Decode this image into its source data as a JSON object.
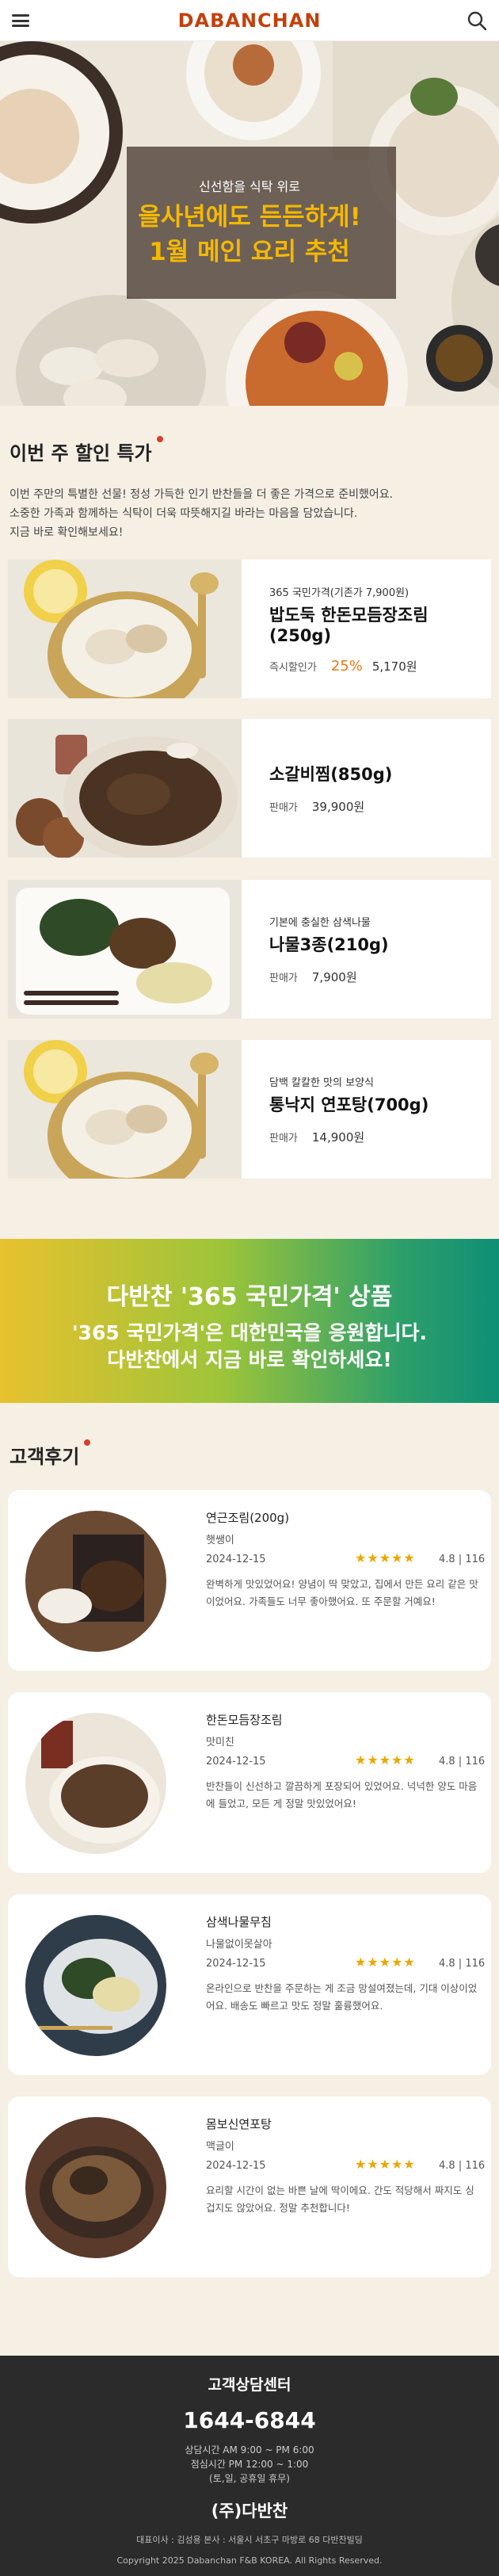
{
  "header": {
    "logo": "DABANCHAN"
  },
  "hero": {
    "subtitle": "신선함을 식탁 위로",
    "title_line1": "을사년에도 든든하게!",
    "title_line2": "1월 메인 요리 추천"
  },
  "discount_section": {
    "title": "이번 주 할인 특가",
    "intro_lines": [
      "이번 주만의 특별한 선물! 정성 가득한 인기 반찬들을 더 좋은 가격으로 준비했어요.",
      "소중한 가족과 함께하는 식탁이 더욱 따뜻해지길 바라는 마음을 담았습니다.",
      "지금 바로 확인해보세요!"
    ],
    "products": [
      {
        "desc": "365 국민가격(기존가 7,900원)",
        "name": "밥도둑 한돈모듬장조림(250g)",
        "label": "즉시할인가",
        "discount": "25%",
        "price": "5,170원"
      },
      {
        "desc": "",
        "name": "소갈비찜(850g)",
        "label": "판매가",
        "discount": "",
        "price": "39,900원"
      },
      {
        "desc": "기본에 충실한 삼색나물",
        "name": "나물3종(210g)",
        "label": "판매가",
        "discount": "",
        "price": "7,900원"
      },
      {
        "desc": "담백 칼칼한 맛의 보양식",
        "name": "통낙지 연포탕(700g)",
        "label": "판매가",
        "discount": "",
        "price": "14,900원"
      }
    ]
  },
  "banner": {
    "line1": "다반찬 '365 국민가격' 상품",
    "line2": "'365 국민가격'은 대한민국을 응원합니다.",
    "line3": "다반찬에서 지금 바로 확인하세요!"
  },
  "reviews_section": {
    "title": "고객후기",
    "reviews": [
      {
        "product": "연근조림(200g)",
        "user": "햇쌩이",
        "date": "2024-12-15",
        "stars": "★★★★★",
        "score": "4.8 | 116",
        "text": "완벽하게 맛있었어요! 양념이 딱 맞았고, 집에서 만든 요리 같은 맛이었어요. 가족들도 너무 좋아했어요. 또 주문할 거예요!"
      },
      {
        "product": "한돈모듬장조림",
        "user": "맛미친",
        "date": "2024-12-15",
        "stars": "★★★★★",
        "score": "4.8 | 116",
        "text": "반찬들이 신선하고 깔끔하게 포장되어 있었어요. 넉넉한 양도 마음에 들었고, 모든 게 정말 맛있었어요!"
      },
      {
        "product": "삼색나물무침",
        "user": "나물없이못살아",
        "date": "2024-12-15",
        "stars": "★★★★★",
        "score": "4.8 | 116",
        "text": "온라인으로 반찬을 주문하는 게 조금 망설여졌는데, 기대 이상이었어요. 배송도 빠르고 맛도 정말 훌륭했어요."
      },
      {
        "product": "몸보신연포탕",
        "user": "맥글이",
        "date": "2024-12-15",
        "stars": "★★★★★",
        "score": "4.8 | 116",
        "text": "요리할 시간이 없는 바쁜 날에 딱이에요. 간도 적당해서 짜지도 싱겁지도 않았어요. 정말 추천합니다!"
      }
    ]
  },
  "footer": {
    "title": "고객상담센터",
    "phone": "1644-6844",
    "hours1": "상담시간 AM 9:00 ~ PM 6:00",
    "hours2": "점심시간 PM 12:00 ~ 1:00",
    "hours3": "(토,일, 공휴일 휴무)",
    "company": "(주)다반찬",
    "address": "대표이사 : 김성용 본사 : 서울시 서초구 마방로 68 다반찬빌딩",
    "copyright": "Copyright 2025 Dabanchan F&B KOREA. All Rights Reserved."
  },
  "colors": {
    "brand": "#c2410c",
    "accent": "#e87a16",
    "hero_title": "#f5b800",
    "star": "#e8a800"
  }
}
